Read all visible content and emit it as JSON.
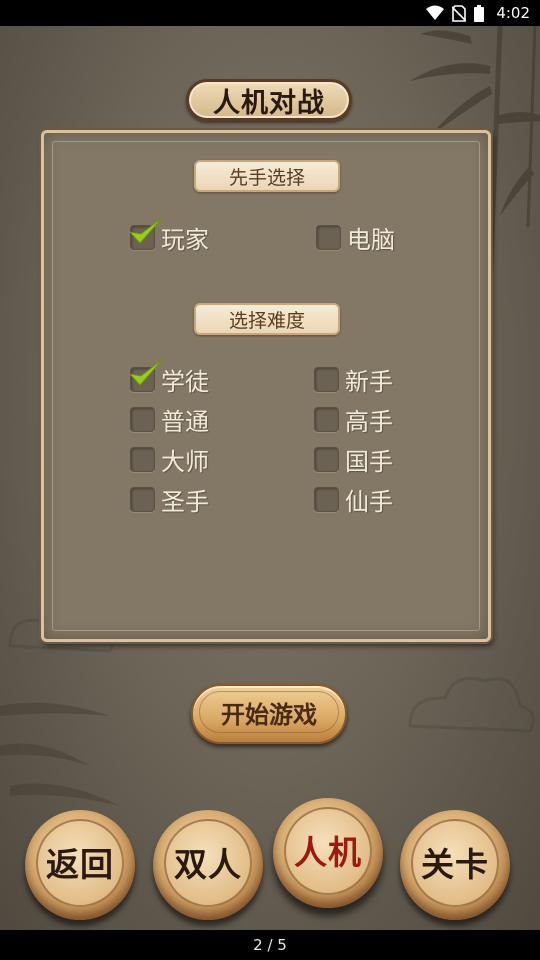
{
  "status_bar": {
    "time": "4:02",
    "icons": [
      "wifi-icon",
      "no-sim-icon",
      "battery-icon"
    ]
  },
  "title": "人机对战",
  "first_move": {
    "label": "先手选择",
    "options": [
      {
        "label": "玩家",
        "checked": true
      },
      {
        "label": "电脑",
        "checked": false
      }
    ]
  },
  "difficulty": {
    "label": "选择难度",
    "options": [
      {
        "label": "学徒",
        "checked": true
      },
      {
        "label": "新手",
        "checked": false
      },
      {
        "label": "普通",
        "checked": false
      },
      {
        "label": "高手",
        "checked": false
      },
      {
        "label": "大师",
        "checked": false
      },
      {
        "label": "国手",
        "checked": false
      },
      {
        "label": "圣手",
        "checked": false
      },
      {
        "label": "仙手",
        "checked": false
      }
    ]
  },
  "start_button": "开始游戏",
  "bottom_pieces": [
    {
      "label": "返回",
      "active": false
    },
    {
      "label": "双人",
      "active": false
    },
    {
      "label": "人机",
      "active": true
    },
    {
      "label": "关卡",
      "active": false
    }
  ],
  "page_indicator": "2 / 5",
  "colors": {
    "check": "#9acd1a",
    "active_piece_text": "#9c1a10",
    "panel": "#837866"
  }
}
